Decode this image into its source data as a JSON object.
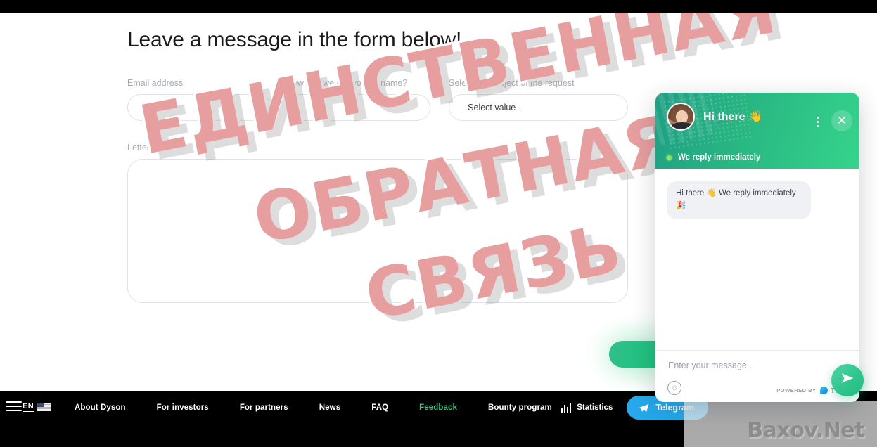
{
  "page": {
    "title": "Leave a message in the form below!"
  },
  "form": {
    "fields": [
      {
        "label": "Email address",
        "value": "",
        "placeholder": ""
      },
      {
        "label": "How can we call you by name?",
        "value": "",
        "placeholder": ""
      },
      {
        "label": "Select the subject of the request",
        "value": "-Select value-",
        "placeholder": ""
      }
    ],
    "letter": {
      "label": "Letter text",
      "value": "",
      "placeholder": ""
    },
    "submit_label": ""
  },
  "watermark": {
    "line1": "ЕДИНСТВЕННАЯ",
    "line2": "ОБРАТНАЯ",
    "line3": "СВЯЗЬ",
    "color": "#e79e9e",
    "site": "Baxov.Net"
  },
  "nav": {
    "language": "EN",
    "links": [
      {
        "label": "About Dyson",
        "active": false
      },
      {
        "label": "For investors",
        "active": false
      },
      {
        "label": "For partners",
        "active": false
      },
      {
        "label": "News",
        "active": false
      },
      {
        "label": "FAQ",
        "active": false
      },
      {
        "label": "Feedback",
        "active": true
      },
      {
        "label": "Bounty program",
        "active": false
      }
    ],
    "statistics_label": "Statistics",
    "telegram_label": "Telegram",
    "accent_active": "#35c37f",
    "telegram_color": "#26a8ea"
  },
  "chat": {
    "title": "Hi there 👋",
    "status": "We reply immediately",
    "messages": [
      {
        "text": "Hi there 👋 We reply immediately 🎉",
        "from": "agent"
      }
    ],
    "input_placeholder": "Enter your message...",
    "input_value": "",
    "powered_by_label": "POWERED BY",
    "brand": "TIDIO",
    "header_color": "#28b682",
    "send_icon": "send-icon",
    "close_icon": "close-icon",
    "menu_icon": "more-vertical-icon",
    "emoji_icon": "emoji-icon"
  }
}
